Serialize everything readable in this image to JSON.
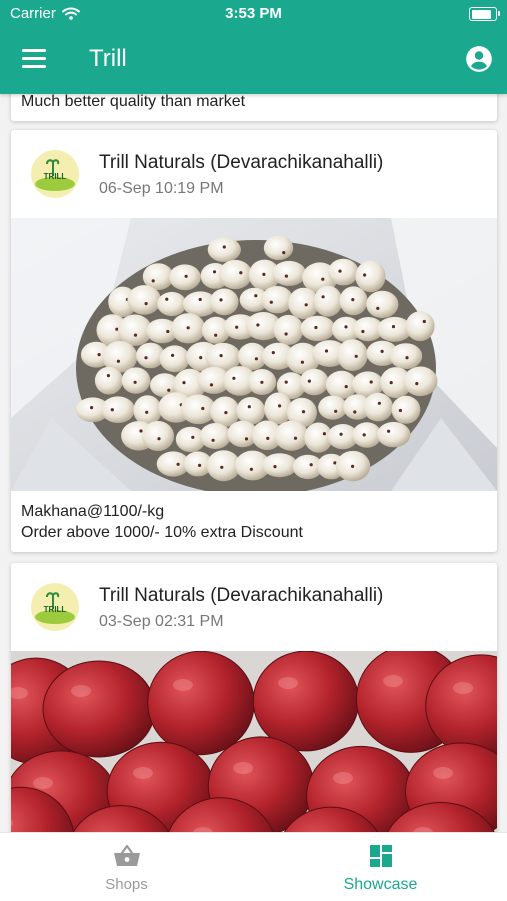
{
  "status": {
    "carrier": "Carrier",
    "time": "3:53 PM",
    "battery_level": 0.9
  },
  "app_bar": {
    "title": "Trill",
    "menu_icon": "hamburger-menu-icon",
    "profile_icon": "account-circle-icon"
  },
  "colors": {
    "primary": "#1aa98f",
    "tab_active": "#1aa98f",
    "tab_inactive": "#9a9a9a"
  },
  "feed": {
    "partial_caption": "Much better quality than market",
    "posts": [
      {
        "shop": "Trill Naturals (Devarachikanahalli)",
        "date": "06-Sep 10:19 PM",
        "image": "makhana-photo",
        "caption_lines": [
          "Makhana@1100/-kg",
          "Order above 1000/- 10% extra Discount"
        ]
      },
      {
        "shop": "Trill Naturals (Devarachikanahalli)",
        "date": "03-Sep 02:31 PM",
        "image": "apples-photo"
      }
    ]
  },
  "bottom_nav": {
    "tabs": [
      {
        "label": "Shops",
        "icon": "shopping-basket-icon",
        "active": false
      },
      {
        "label": "Showcase",
        "icon": "dashboard-icon",
        "active": true
      }
    ]
  }
}
